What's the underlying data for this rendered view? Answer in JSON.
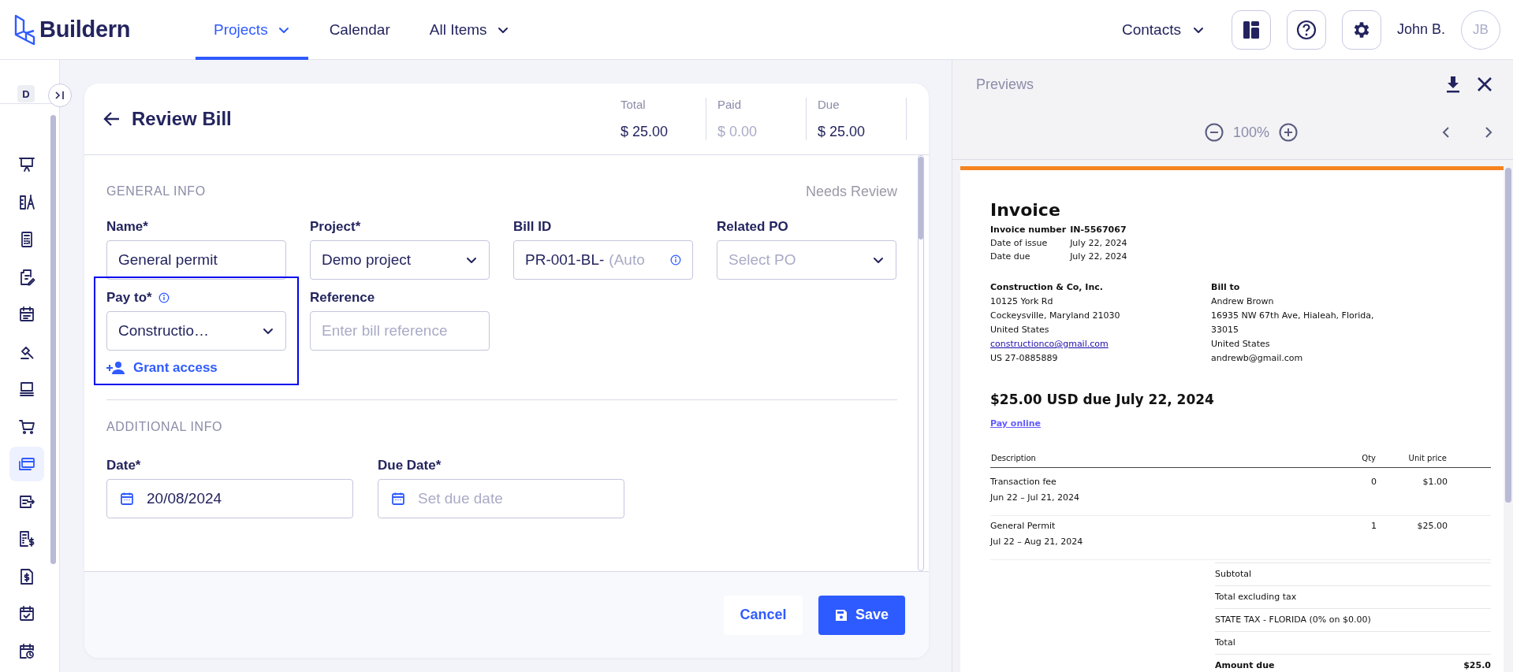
{
  "app_bar": {
    "logo": "Buildern",
    "nav": [
      {
        "label": "Projects",
        "selected": true,
        "dropdown": true
      },
      {
        "label": "Calendar",
        "selected": false,
        "dropdown": false
      },
      {
        "label": "All Items",
        "selected": false,
        "dropdown": true
      }
    ],
    "contacts": "Contacts",
    "user_name": "John B.",
    "avatar_initials": "JB"
  },
  "sidebar": {
    "project_badge": "D",
    "items": [
      {
        "kind": "easel",
        "selected": false
      },
      {
        "kind": "drafting",
        "selected": false
      },
      {
        "kind": "calculator",
        "selected": false
      },
      {
        "kind": "document_edit",
        "selected": false
      },
      {
        "kind": "calendar",
        "selected": false
      },
      {
        "kind": "gavel",
        "selected": false
      },
      {
        "kind": "laptop",
        "selected": false
      },
      {
        "kind": "cart",
        "selected": false
      },
      {
        "kind": "cards",
        "selected": true
      },
      {
        "kind": "export_document",
        "selected": false
      },
      {
        "kind": "calculator_dollar",
        "selected": false
      },
      {
        "kind": "dollar_document",
        "selected": false
      },
      {
        "kind": "calendar_check",
        "selected": false
      },
      {
        "kind": "calendar_clock",
        "selected": false
      }
    ]
  },
  "bill": {
    "title": "Review Bill",
    "summary": [
      {
        "label": "Total",
        "value": "$ 25.00",
        "muted": false
      },
      {
        "label": "Paid",
        "value": "$ 0.00",
        "muted": true
      },
      {
        "label": "Due",
        "value": "$ 25.00",
        "muted": false
      }
    ],
    "general_info": {
      "heading": "GENERAL INFO",
      "status": "Needs Review",
      "fields": [
        {
          "label": "Name*",
          "kind": "text",
          "value": "General permit"
        },
        {
          "label": "Project*",
          "kind": "select",
          "value": "Demo project"
        },
        {
          "label": "Bill ID",
          "kind": "id",
          "value": "PR-001-BL-",
          "hint": "(Auto"
        },
        {
          "label": "Related PO",
          "kind": "select",
          "placeholder": "Select PO"
        },
        {
          "label": "Pay to*",
          "kind": "select",
          "value": "Constructio…",
          "info": true,
          "highlighted": true,
          "link": "Grant access"
        },
        {
          "label": "Reference",
          "kind": "text",
          "placeholder": "Enter bill reference"
        }
      ]
    },
    "additional_info": {
      "heading": "ADDITIONAL INFO",
      "fields": [
        {
          "label": "Date*",
          "kind": "date",
          "value": "20/08/2024"
        },
        {
          "label": "Due Date*",
          "kind": "date",
          "placeholder": "Set due date"
        }
      ]
    },
    "buttons": {
      "cancel": "Cancel",
      "save": "Save"
    }
  },
  "preview": {
    "title": "Previews",
    "zoom": "100%",
    "invoice": {
      "title": "Invoice",
      "meta": [
        {
          "label": "Invoice number",
          "value": "IN-5567067",
          "bold": true
        },
        {
          "label": "Date of issue",
          "value": "July 22, 2024",
          "bold": false
        },
        {
          "label": "Date due",
          "value": "July 22, 2024",
          "bold": false
        }
      ],
      "from": {
        "name": "Construction & Co, Inc.",
        "lines": [
          "10125 York Rd",
          "Cockeysville, Maryland 21030",
          "United States"
        ],
        "email": "constructionco@gmail.com",
        "tax_id": "US 27-0885889"
      },
      "bill_to": {
        "heading": "Bill to",
        "lines": [
          "Andrew Brown",
          "16935 NW 67th Ave, Hialeah, Florida,",
          "33015",
          "United States",
          "andrewb@gmail.com"
        ]
      },
      "due_line": "$25.00 USD due July 22, 2024",
      "pay_link": "Pay online",
      "table": {
        "columns": [
          "Description",
          "Qty",
          "Unit price"
        ],
        "rows": [
          {
            "description": "Transaction fee",
            "period": "Jun 22 – Jul 21, 2024",
            "qty": "0",
            "unit_price": "$1.00"
          },
          {
            "description": "General Permit",
            "period": "Jul 22 – Aug 21, 2024",
            "qty": "1",
            "unit_price": "$25.00"
          }
        ]
      },
      "totals": [
        {
          "label": "Subtotal",
          "bold": false
        },
        {
          "label": "Total excluding tax",
          "bold": false
        },
        {
          "label": "STATE TAX - FLORIDA (0% on $0.00)",
          "bold": false
        },
        {
          "label": "Total",
          "bold": false
        },
        {
          "label": "Amount due",
          "value": "$25.0",
          "bold": true
        }
      ]
    }
  }
}
